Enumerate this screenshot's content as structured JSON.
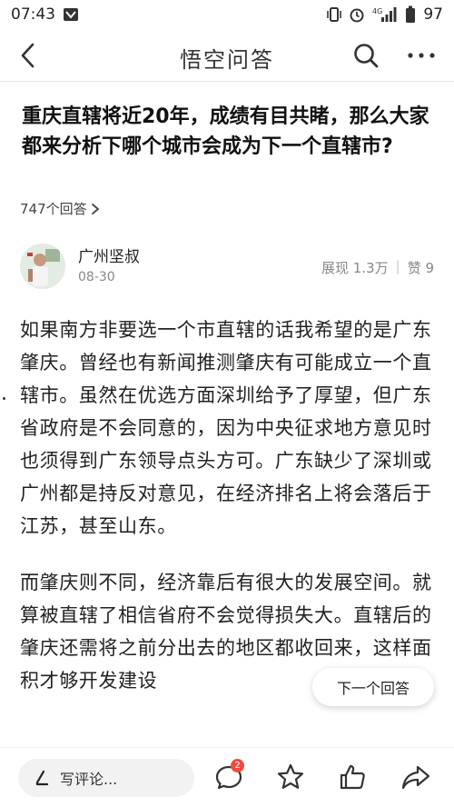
{
  "status_bar": {
    "time": "07:43",
    "network": "4G",
    "battery": "97"
  },
  "header": {
    "title": "悟空问答"
  },
  "question": {
    "title": "重庆直辖将近20年，成绩有目共睹，那么大家都来分析下哪个城市会成为下一个直辖市?",
    "answer_count": "747个回答"
  },
  "author": {
    "name": "广州坚叔",
    "date": "08-30",
    "views": "展现 1.3万",
    "likes": "赞 9"
  },
  "answer": {
    "paragraphs": [
      "如果南方非要选一个市直辖的话我希望的是广东肇庆。曾经也有新闻推测肇庆有可能成立一个直辖市。虽然在优选方面深圳给予了厚望，但广东省政府是不会同意的，因为中央征求地方意见时也须得到广东领导点头方可。广东缺少了深圳或广州都是持反对意见，在经济排名上将会落后于江苏，甚至山东。",
      "而肇庆则不同，经济靠后有很大的发展空间。就算被直辖了相信省府不会觉得损失大。直辖后的肇庆还需将之前分出去的地区都收回来，这样面积才够开发建设"
    ]
  },
  "floating": {
    "next_answer": "下一个回答"
  },
  "bottom_bar": {
    "comment_placeholder": "写评论...",
    "comment_badge": "2"
  },
  "icons": {
    "back": "chevron-left-icon",
    "search": "search-icon",
    "more": "more-dots-icon",
    "pen": "pen-icon",
    "comment": "comment-bubble-icon",
    "favorite": "star-icon",
    "like": "thumbs-up-icon",
    "share": "share-arrow-icon"
  },
  "colors": {
    "badge": "#f04b3e",
    "text_primary": "#222222",
    "text_secondary": "#888888"
  }
}
